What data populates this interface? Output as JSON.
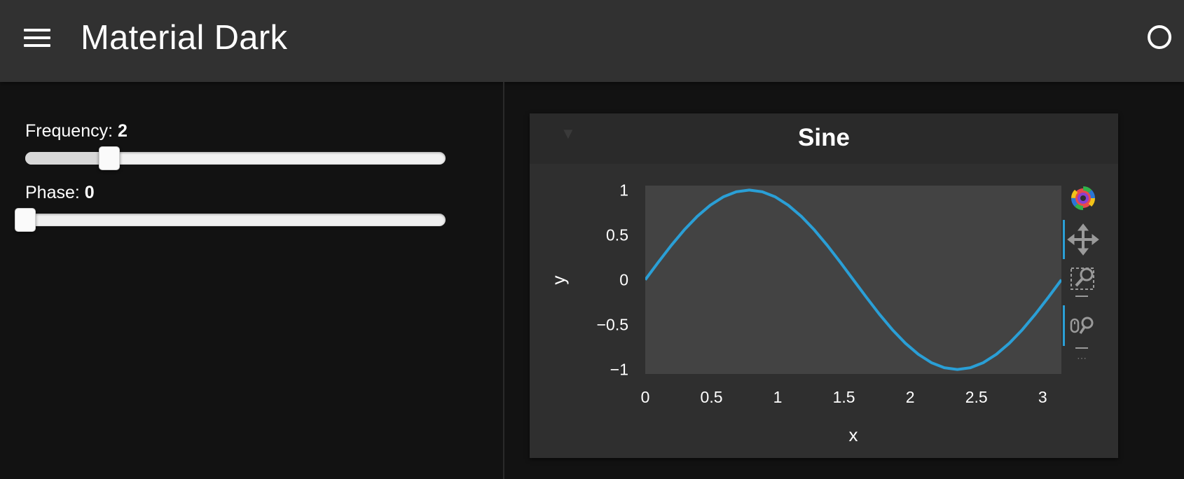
{
  "header": {
    "title": "Material Dark",
    "menu_icon": "hamburger-menu-icon",
    "status_icon": "busy-indicator-icon"
  },
  "sidebar": {
    "frequency": {
      "label": "Frequency: ",
      "value": "2",
      "min": 0,
      "max": 10,
      "current": 2
    },
    "phase": {
      "label": "Phase: ",
      "value": "0",
      "min": 0,
      "max": 3.14,
      "current": 0
    }
  },
  "card": {
    "collapse_icon": "collapse-triangle-icon",
    "title": "Sine"
  },
  "toolbar": {
    "logo": "bokeh-logo-icon",
    "tools": [
      "pan-icon",
      "box-zoom-icon",
      "wheel-zoom-icon"
    ],
    "active_accent": "#2a9fd6"
  },
  "colors": {
    "app_bar": "#313131",
    "background": "#121212",
    "card": "#2f2f2f",
    "plot_area": "#434343",
    "line": "#2a9fd6"
  },
  "chart_data": {
    "type": "line",
    "title": "Sine",
    "xlabel": "x",
    "ylabel": "y",
    "xlim": [
      0,
      3.14159
    ],
    "ylim": [
      -1.05,
      1.05
    ],
    "xticks": [
      0,
      0.5,
      1,
      1.5,
      2,
      2.5,
      3
    ],
    "xtick_labels": [
      "0",
      "0.5",
      "1",
      "1.5",
      "2",
      "2.5",
      "3"
    ],
    "yticks": [
      1,
      0.5,
      0,
      -0.5,
      -1
    ],
    "ytick_labels": [
      "1",
      "0.5",
      "0",
      "−0.5",
      "−1"
    ],
    "grid": false,
    "series": [
      {
        "color": "#2a9fd6",
        "x": [
          0,
          0.0982,
          0.1963,
          0.2945,
          0.3927,
          0.4909,
          0.589,
          0.6872,
          0.7854,
          0.8836,
          0.9817,
          1.0799,
          1.1781,
          1.2763,
          1.3744,
          1.4726,
          1.5708,
          1.669,
          1.7671,
          1.8653,
          1.9635,
          2.0617,
          2.1598,
          2.258,
          2.3562,
          2.4544,
          2.5525,
          2.6507,
          2.7489,
          2.8471,
          2.9452,
          3.0434,
          3.1416
        ],
        "y": [
          0,
          0.195,
          0.383,
          0.556,
          0.707,
          0.831,
          0.924,
          0.981,
          1,
          0.981,
          0.924,
          0.831,
          0.707,
          0.556,
          0.383,
          0.195,
          0,
          -0.195,
          -0.383,
          -0.556,
          -0.707,
          -0.831,
          -0.924,
          -0.981,
          -1,
          -0.981,
          -0.924,
          -0.831,
          -0.707,
          -0.556,
          -0.383,
          -0.195,
          0
        ]
      }
    ]
  }
}
